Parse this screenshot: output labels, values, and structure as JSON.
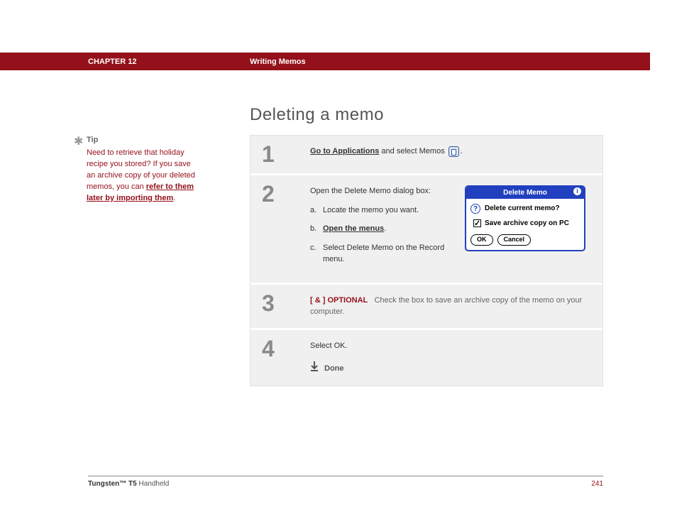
{
  "header": {
    "chapter": "CHAPTER 12",
    "section": "Writing Memos"
  },
  "title": "Deleting a memo",
  "tip": {
    "label": "Tip",
    "text_before": "Need to retrieve that holiday recipe you stored? If you save an archive copy of your deleted memos, you can ",
    "link": "refer to them later by importing them",
    "text_after": "."
  },
  "steps": [
    {
      "num": "1",
      "link": "Go to Applications",
      "text_after": " and select Memos ",
      "trailing": "."
    },
    {
      "num": "2",
      "intro": "Open the Delete Memo dialog box:",
      "items": [
        {
          "letter": "a.",
          "text": "Locate the memo you want."
        },
        {
          "letter": "b.",
          "link": "Open the menus",
          "after": "."
        },
        {
          "letter": "c.",
          "text": "Select Delete Memo on the Record menu."
        }
      ],
      "dialog": {
        "title": "Delete Memo",
        "question": "Delete current memo?",
        "checkbox": "Save archive copy on PC",
        "ok": "OK",
        "cancel": "Cancel"
      }
    },
    {
      "num": "3",
      "optional_tag": "[ & ]  OPTIONAL",
      "text": "Check the box to save an archive copy of the memo on your computer."
    },
    {
      "num": "4",
      "text": "Select OK.",
      "done": "Done"
    }
  ],
  "footer": {
    "product_bold": "Tungsten™ T5",
    "product_rest": " Handheld",
    "page": "241"
  }
}
